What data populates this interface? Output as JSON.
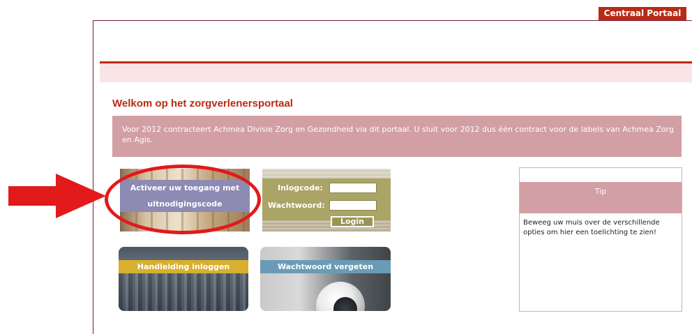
{
  "header": {
    "portal_tab": "Centraal Portaal"
  },
  "main": {
    "title": "Welkom op het zorgverlenersportaal",
    "intro": "Voor 2012 contracteert Achmea Divisie Zorg en Gezondheid via dit portaal. U sluit voor 2012 dus één contract voor de labels van Achmea Zorg en Agis."
  },
  "tiles": {
    "activeer_line1": "Activeer uw toegang met",
    "activeer_line2": "uitnodigingscode",
    "login_code_label": "Inlogcode:",
    "password_label": "Wachtwoord:",
    "login_button": "Login",
    "login_code_value": "",
    "password_value": "",
    "handleiding": "Handleiding inloggen",
    "wachtwoord_vergeten": "Wachtwoord vergeten"
  },
  "tip": {
    "title": "Tip",
    "text": "Beweeg uw muis over de verschillende opties om hier een toelichting te zien!"
  },
  "colors": {
    "brand_red": "#b82b14",
    "intro_bg": "#d29fa5",
    "annotation_red": "#e21a1a"
  },
  "icons": {
    "annotation_arrow": "right-arrow-icon",
    "annotation_circle": "highlight-ellipse"
  }
}
